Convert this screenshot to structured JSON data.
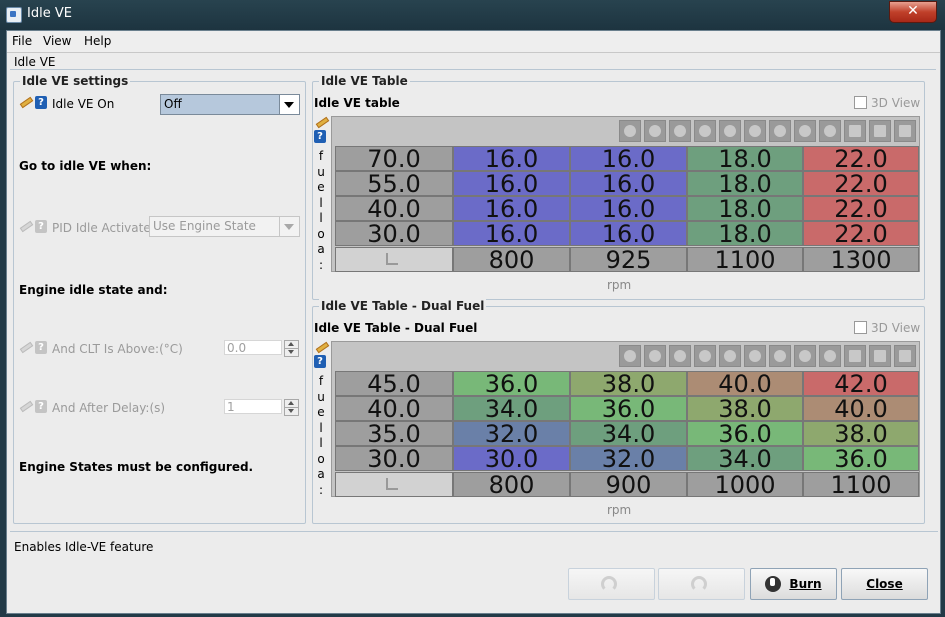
{
  "window": {
    "title": "Idle VE",
    "close_icon": "close-icon"
  },
  "menu": {
    "file": "File",
    "view": "View",
    "help": "Help"
  },
  "tab_title": "Idle VE",
  "settings": {
    "group_title": "Idle VE settings",
    "idle_ve_on_label": "Idle VE On",
    "idle_ve_on_value": "Off",
    "go_to_label": "Go to idle VE when:",
    "pid_label": "PID Idle Activates",
    "pid_value": "Use Engine State",
    "engine_idle_label": "Engine idle state and:",
    "clt_label": "And CLT Is Above:(°C)",
    "clt_value": "0.0",
    "delay_label": "And After Delay:(s)",
    "delay_value": "1",
    "configured_note": "Engine States must be configured."
  },
  "table1": {
    "group_title": "Idle VE Table",
    "title": "Idle VE table",
    "view3d": "3D View",
    "y_axis_letters": [
      "f",
      "u",
      "e",
      "l",
      "l",
      "o",
      "a",
      ":"
    ],
    "rows": [
      {
        "y": "70.0",
        "cells": [
          "16.0",
          "16.0",
          "18.0",
          "22.0"
        ]
      },
      {
        "y": "55.0",
        "cells": [
          "16.0",
          "16.0",
          "18.0",
          "22.0"
        ]
      },
      {
        "y": "40.0",
        "cells": [
          "16.0",
          "16.0",
          "18.0",
          "22.0"
        ]
      },
      {
        "y": "30.0",
        "cells": [
          "16.0",
          "16.0",
          "18.0",
          "22.0"
        ]
      }
    ],
    "x": [
      "800",
      "925",
      "1100",
      "1300"
    ],
    "x_label": "rpm",
    "colors": [
      [
        "#6b6bc8",
        "#6b6bc8",
        "#6e9f7e",
        "#c96a6a"
      ],
      [
        "#6b6bc8",
        "#6b6bc8",
        "#6e9f7e",
        "#c96a6a"
      ],
      [
        "#6b6bc8",
        "#6b6bc8",
        "#6e9f7e",
        "#c96a6a"
      ],
      [
        "#6b6bc8",
        "#6b6bc8",
        "#6e9f7e",
        "#c96a6a"
      ]
    ]
  },
  "table2": {
    "group_title": "Idle VE Table - Dual Fuel",
    "title": "Idle VE Table - Dual Fuel",
    "view3d": "3D View",
    "y_axis_letters": [
      "f",
      "u",
      "e",
      "l",
      "l",
      "o",
      "a",
      ":"
    ],
    "rows": [
      {
        "y": "45.0",
        "cells": [
          "36.0",
          "38.0",
          "40.0",
          "42.0"
        ]
      },
      {
        "y": "40.0",
        "cells": [
          "34.0",
          "36.0",
          "38.0",
          "40.0"
        ]
      },
      {
        "y": "35.0",
        "cells": [
          "32.0",
          "34.0",
          "36.0",
          "38.0"
        ]
      },
      {
        "y": "30.0",
        "cells": [
          "30.0",
          "32.0",
          "34.0",
          "36.0"
        ]
      }
    ],
    "x": [
      "800",
      "900",
      "1000",
      "1100"
    ],
    "x_label": "rpm",
    "colors": [
      [
        "#78b878",
        "#8ea86e",
        "#ac8c74",
        "#c96a6a"
      ],
      [
        "#6e9f7e",
        "#78b878",
        "#8ea86e",
        "#ac8c74"
      ],
      [
        "#6a80a8",
        "#6e9f7e",
        "#78b878",
        "#8ea86e"
      ],
      [
        "#6b6bc8",
        "#6a80a8",
        "#6e9f7e",
        "#78b878"
      ]
    ]
  },
  "status_text": "Enables Idle-VE feature",
  "buttons": {
    "burn": "Burn",
    "close": "Close"
  }
}
